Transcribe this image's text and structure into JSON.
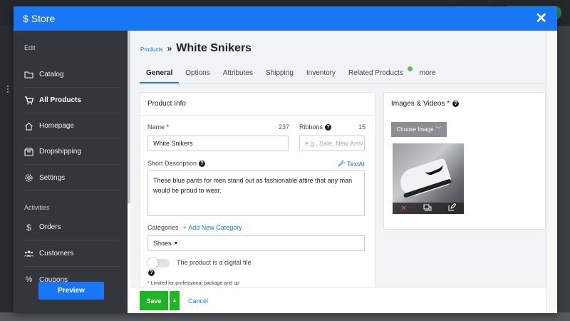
{
  "modal": {
    "title": "Store",
    "close_label": "✕"
  },
  "sidebar": {
    "section_edit": "Edit",
    "section_activities": "Activities",
    "items": [
      {
        "label": "Catalog",
        "icon": "folder-icon"
      },
      {
        "label": "All Products",
        "icon": "cart-icon"
      },
      {
        "label": "Homepage",
        "icon": "home-icon"
      },
      {
        "label": "Dropshipping",
        "icon": "box-icon"
      },
      {
        "label": "Settings",
        "icon": "gear-icon"
      },
      {
        "label": "Orders",
        "icon": "dollar-icon"
      },
      {
        "label": "Customers",
        "icon": "users-icon"
      },
      {
        "label": "Coupons",
        "icon": "percent-icon"
      }
    ],
    "active_item": "All Products",
    "preview_label": "Preview"
  },
  "breadcrumb": {
    "parent": "Products",
    "separator": "»",
    "current": "White Snikers"
  },
  "tabs": [
    {
      "label": "General"
    },
    {
      "label": "Options"
    },
    {
      "label": "Attributes"
    },
    {
      "label": "Shipping"
    },
    {
      "label": "Inventory"
    },
    {
      "label": "Related Products"
    },
    {
      "label": "more"
    }
  ],
  "product_info": {
    "title": "Product Info",
    "name_label": "Name *",
    "name_counter": "237",
    "name_value": "White Snikers",
    "ribbons_label": "Ribbons",
    "ribbons_counter": "15",
    "ribbons_placeholder": "e.g., Sale, New Arriv",
    "short_desc_label": "Short Description",
    "textai_label": "TextAI",
    "short_desc_value": "These blue pants for men stand out as fashionable attire that any man would be proud to wear.",
    "categories_label": "Categories",
    "add_category_label": "+ Add New Category",
    "category_value": "Shoes",
    "digital_label": "The product is a digital file",
    "digital_enabled": false,
    "limited_note": "* Limited for professional package and up"
  },
  "images": {
    "title": "Images & Videos *",
    "choose_label": "Choose Image"
  },
  "footer": {
    "save_label": "Save",
    "cancel_label": "Cancel"
  },
  "colors": {
    "accent": "#1976f6",
    "sidebar_bg": "#33373c",
    "save_green": "#1fb524",
    "tab_dot": "#5cb85c"
  }
}
